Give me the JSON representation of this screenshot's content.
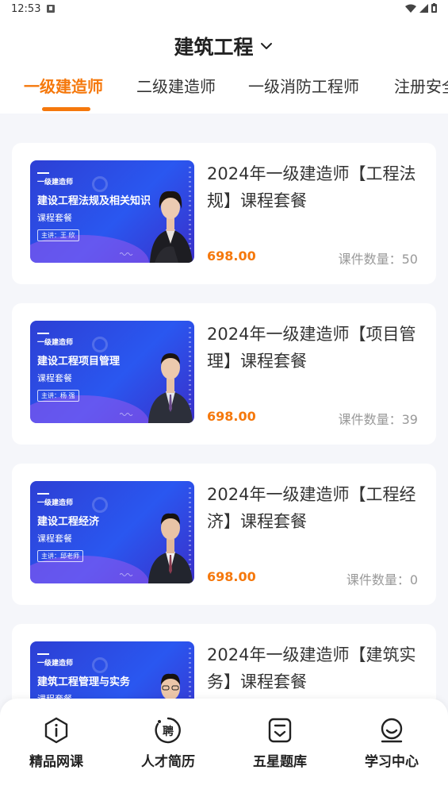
{
  "status_bar": {
    "time": "12:53",
    "icons": [
      "notification-icon",
      "wifi-icon",
      "signal-icon",
      "battery-icon"
    ]
  },
  "header": {
    "category": "建筑工程",
    "category_icon": "chevron-down-icon"
  },
  "tabs": [
    {
      "label": "一级建造师",
      "active": true
    },
    {
      "label": "二级建造师",
      "active": false
    },
    {
      "label": "一级消防工程师",
      "active": false
    },
    {
      "label": "注册安全",
      "active": false
    }
  ],
  "courses": [
    {
      "thumb_series": "一级建造师",
      "thumb_title": "建设工程法规及相关知识",
      "thumb_pkg": "课程套餐",
      "thumb_lecturer": "主讲：王 欣",
      "title": "2024年一级建造师【工程法规】课程套餐",
      "price": "698.00",
      "count_label": "课件数量：50"
    },
    {
      "thumb_series": "一级建造师",
      "thumb_title": "建设工程项目管理",
      "thumb_pkg": "课程套餐",
      "thumb_lecturer": "主讲：杨 强",
      "title": "2024年一级建造师【项目管理】课程套餐",
      "price": "698.00",
      "count_label": "课件数量：39"
    },
    {
      "thumb_series": "一级建造师",
      "thumb_title": "建设工程经济",
      "thumb_pkg": "课程套餐",
      "thumb_lecturer": "主讲：邱老师",
      "title": "2024年一级建造师【工程经济】课程套餐",
      "price": "698.00",
      "count_label": "课件数量：0"
    },
    {
      "thumb_series": "一级建造师",
      "thumb_title": "建筑工程管理与实务",
      "thumb_pkg": "课程套餐",
      "thumb_lecturer": "",
      "title": "2024年一级建造师【建筑实务】课程套餐",
      "price": "",
      "count_label": ""
    }
  ],
  "bottom_nav": [
    {
      "label": "精品网课",
      "icon": "info-circle-icon"
    },
    {
      "label": "人才简历",
      "icon": "hire-badge-icon"
    },
    {
      "label": "五星题库",
      "icon": "question-bank-icon"
    },
    {
      "label": "学习中心",
      "icon": "user-face-icon"
    }
  ],
  "colors": {
    "accent": "#f5780c",
    "background": "#f5f6fa",
    "thumbnail": "#2a57f0",
    "muted_text": "#999999"
  }
}
